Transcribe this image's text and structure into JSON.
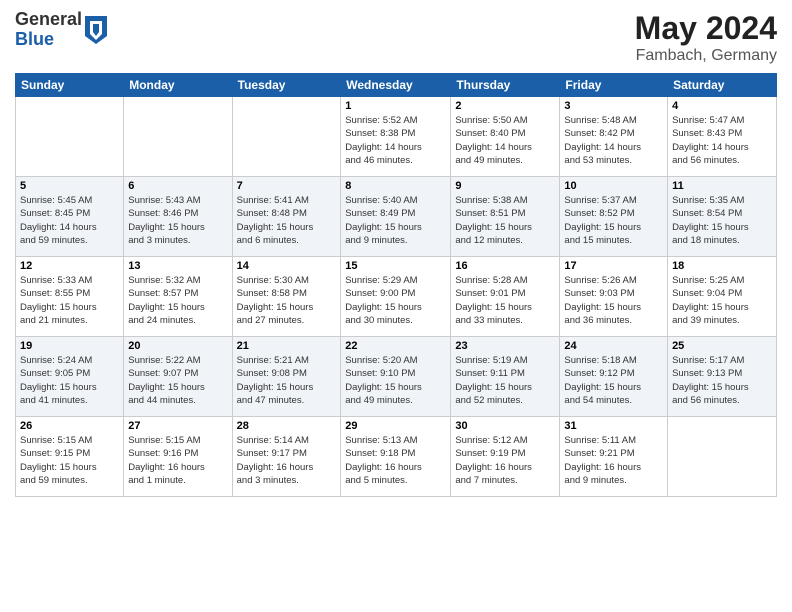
{
  "header": {
    "logo_general": "General",
    "logo_blue": "Blue",
    "month": "May 2024",
    "location": "Fambach, Germany"
  },
  "days_of_week": [
    "Sunday",
    "Monday",
    "Tuesday",
    "Wednesday",
    "Thursday",
    "Friday",
    "Saturday"
  ],
  "weeks": [
    [
      {
        "day": "",
        "info": ""
      },
      {
        "day": "",
        "info": ""
      },
      {
        "day": "",
        "info": ""
      },
      {
        "day": "1",
        "info": "Sunrise: 5:52 AM\nSunset: 8:38 PM\nDaylight: 14 hours\nand 46 minutes."
      },
      {
        "day": "2",
        "info": "Sunrise: 5:50 AM\nSunset: 8:40 PM\nDaylight: 14 hours\nand 49 minutes."
      },
      {
        "day": "3",
        "info": "Sunrise: 5:48 AM\nSunset: 8:42 PM\nDaylight: 14 hours\nand 53 minutes."
      },
      {
        "day": "4",
        "info": "Sunrise: 5:47 AM\nSunset: 8:43 PM\nDaylight: 14 hours\nand 56 minutes."
      }
    ],
    [
      {
        "day": "5",
        "info": "Sunrise: 5:45 AM\nSunset: 8:45 PM\nDaylight: 14 hours\nand 59 minutes."
      },
      {
        "day": "6",
        "info": "Sunrise: 5:43 AM\nSunset: 8:46 PM\nDaylight: 15 hours\nand 3 minutes."
      },
      {
        "day": "7",
        "info": "Sunrise: 5:41 AM\nSunset: 8:48 PM\nDaylight: 15 hours\nand 6 minutes."
      },
      {
        "day": "8",
        "info": "Sunrise: 5:40 AM\nSunset: 8:49 PM\nDaylight: 15 hours\nand 9 minutes."
      },
      {
        "day": "9",
        "info": "Sunrise: 5:38 AM\nSunset: 8:51 PM\nDaylight: 15 hours\nand 12 minutes."
      },
      {
        "day": "10",
        "info": "Sunrise: 5:37 AM\nSunset: 8:52 PM\nDaylight: 15 hours\nand 15 minutes."
      },
      {
        "day": "11",
        "info": "Sunrise: 5:35 AM\nSunset: 8:54 PM\nDaylight: 15 hours\nand 18 minutes."
      }
    ],
    [
      {
        "day": "12",
        "info": "Sunrise: 5:33 AM\nSunset: 8:55 PM\nDaylight: 15 hours\nand 21 minutes."
      },
      {
        "day": "13",
        "info": "Sunrise: 5:32 AM\nSunset: 8:57 PM\nDaylight: 15 hours\nand 24 minutes."
      },
      {
        "day": "14",
        "info": "Sunrise: 5:30 AM\nSunset: 8:58 PM\nDaylight: 15 hours\nand 27 minutes."
      },
      {
        "day": "15",
        "info": "Sunrise: 5:29 AM\nSunset: 9:00 PM\nDaylight: 15 hours\nand 30 minutes."
      },
      {
        "day": "16",
        "info": "Sunrise: 5:28 AM\nSunset: 9:01 PM\nDaylight: 15 hours\nand 33 minutes."
      },
      {
        "day": "17",
        "info": "Sunrise: 5:26 AM\nSunset: 9:03 PM\nDaylight: 15 hours\nand 36 minutes."
      },
      {
        "day": "18",
        "info": "Sunrise: 5:25 AM\nSunset: 9:04 PM\nDaylight: 15 hours\nand 39 minutes."
      }
    ],
    [
      {
        "day": "19",
        "info": "Sunrise: 5:24 AM\nSunset: 9:05 PM\nDaylight: 15 hours\nand 41 minutes."
      },
      {
        "day": "20",
        "info": "Sunrise: 5:22 AM\nSunset: 9:07 PM\nDaylight: 15 hours\nand 44 minutes."
      },
      {
        "day": "21",
        "info": "Sunrise: 5:21 AM\nSunset: 9:08 PM\nDaylight: 15 hours\nand 47 minutes."
      },
      {
        "day": "22",
        "info": "Sunrise: 5:20 AM\nSunset: 9:10 PM\nDaylight: 15 hours\nand 49 minutes."
      },
      {
        "day": "23",
        "info": "Sunrise: 5:19 AM\nSunset: 9:11 PM\nDaylight: 15 hours\nand 52 minutes."
      },
      {
        "day": "24",
        "info": "Sunrise: 5:18 AM\nSunset: 9:12 PM\nDaylight: 15 hours\nand 54 minutes."
      },
      {
        "day": "25",
        "info": "Sunrise: 5:17 AM\nSunset: 9:13 PM\nDaylight: 15 hours\nand 56 minutes."
      }
    ],
    [
      {
        "day": "26",
        "info": "Sunrise: 5:15 AM\nSunset: 9:15 PM\nDaylight: 15 hours\nand 59 minutes."
      },
      {
        "day": "27",
        "info": "Sunrise: 5:15 AM\nSunset: 9:16 PM\nDaylight: 16 hours\nand 1 minute."
      },
      {
        "day": "28",
        "info": "Sunrise: 5:14 AM\nSunset: 9:17 PM\nDaylight: 16 hours\nand 3 minutes."
      },
      {
        "day": "29",
        "info": "Sunrise: 5:13 AM\nSunset: 9:18 PM\nDaylight: 16 hours\nand 5 minutes."
      },
      {
        "day": "30",
        "info": "Sunrise: 5:12 AM\nSunset: 9:19 PM\nDaylight: 16 hours\nand 7 minutes."
      },
      {
        "day": "31",
        "info": "Sunrise: 5:11 AM\nSunset: 9:21 PM\nDaylight: 16 hours\nand 9 minutes."
      },
      {
        "day": "",
        "info": ""
      }
    ]
  ]
}
